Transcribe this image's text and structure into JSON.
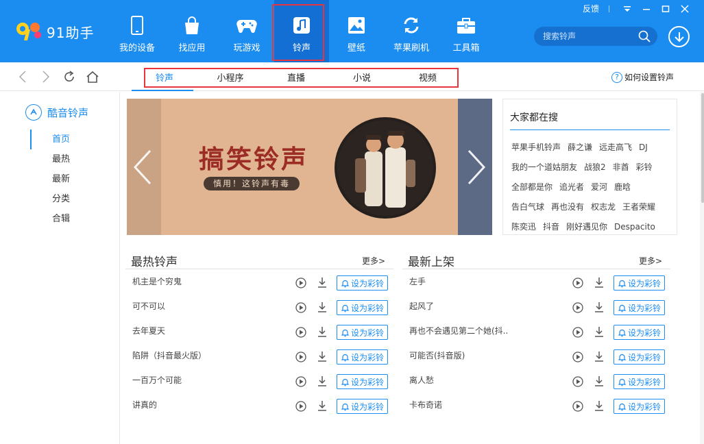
{
  "app": {
    "logo_text": "91助手",
    "brand_color": "#1b8cf0"
  },
  "nav": {
    "items": [
      {
        "label": "我的设备",
        "icon": "phone-icon"
      },
      {
        "label": "找应用",
        "icon": "bag-icon"
      },
      {
        "label": "玩游戏",
        "icon": "gamepad-icon"
      },
      {
        "label": "铃声",
        "icon": "music-note-icon",
        "active": true
      },
      {
        "label": "壁纸",
        "icon": "picture-icon"
      },
      {
        "label": "苹果刷机",
        "icon": "refresh-icon"
      },
      {
        "label": "工具箱",
        "icon": "toolbox-icon"
      }
    ]
  },
  "window": {
    "feedback": "反馈"
  },
  "search": {
    "placeholder": "搜索铃声"
  },
  "subtabs": {
    "items": [
      "铃声",
      "小程序",
      "直播",
      "小说",
      "视频"
    ]
  },
  "howto": {
    "label": "如何设置铃声"
  },
  "sidebar": {
    "title": "酷音铃声",
    "items": [
      "首页",
      "最热",
      "最新",
      "分类",
      "合辑"
    ]
  },
  "banner": {
    "title": "搞笑铃声",
    "subtitle": "慎用！这铃声有毒"
  },
  "trending": {
    "title": "大家都在搜",
    "rows": [
      [
        "苹果手机铃声",
        "薛之谦",
        "远走高飞",
        "DJ"
      ],
      [
        "我的一个道姑朋友",
        "战狼2",
        "非酋",
        "彩铃"
      ],
      [
        "全部都是你",
        "追光者",
        "爱河",
        "鹿晗"
      ],
      [
        "告白气球",
        "再也没有",
        "权志龙",
        "王者荣耀"
      ],
      [
        "陈奕迅",
        "抖音",
        "刚好遇见你",
        "Despacito"
      ]
    ]
  },
  "hot": {
    "title": "最热铃声",
    "more": "更多>",
    "items": [
      "机主是个穷鬼",
      "可不可以",
      "去年夏天",
      "陷阱（抖音最火版）",
      "一百万个可能",
      "讲真的"
    ]
  },
  "newest": {
    "title": "最新上架",
    "more": "更多>",
    "items": [
      "左手",
      "起风了",
      "再也不会遇见第二个她(抖..",
      "可能否(抖音版)",
      "离人愁",
      "卡布奇诺"
    ]
  },
  "row_button": "设为彩铃"
}
